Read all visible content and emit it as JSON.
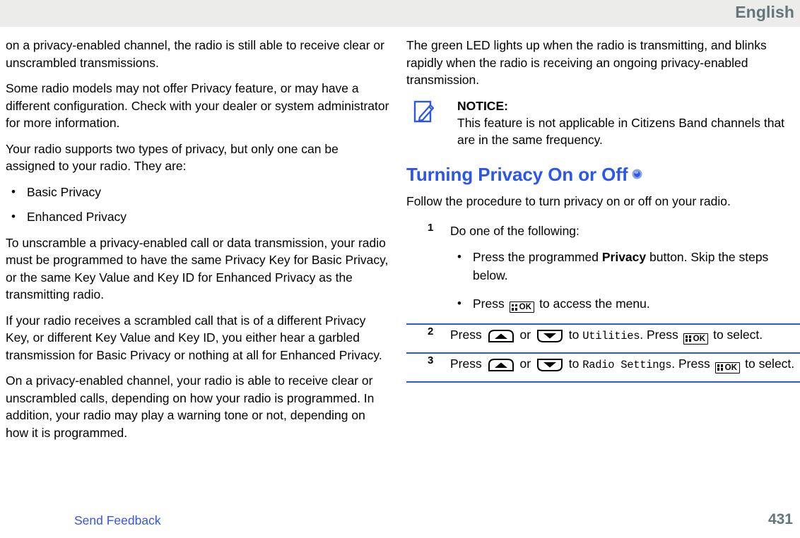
{
  "header": {
    "language": "English",
    "band_color": "#ececea",
    "text_color": "#64767c"
  },
  "left_column": {
    "paragraphs": [
      "on a privacy-enabled channel, the radio is still able to receive clear or unscrambled transmissions.",
      "Some radio models may not offer Privacy feature, or may have a different configuration. Check with your dealer or system administrator for more information.",
      "Your radio supports two types of privacy, but only one can be assigned to your radio. They are:"
    ],
    "bullets": [
      "Basic Privacy",
      "Enhanced Privacy"
    ],
    "paragraphs_after": [
      "To unscramble a privacy-enabled call or data transmission, your radio must be programmed to have the same Privacy Key for Basic Privacy, or the same Key Value and Key ID for Enhanced Privacy as the transmitting radio.",
      "If your radio receives a scrambled call that is of a different Privacy Key, or different Key Value and Key ID, you either hear a garbled transmission for Basic Privacy or nothing at all for Enhanced Privacy.",
      "On a privacy-enabled channel, your radio is able to receive clear or unscrambled calls, depending on how your radio is programmed. In addition, your radio may play a warning tone or not, depending on how it is programmed."
    ]
  },
  "right_column": {
    "intro_paragraph": "The green LED lights up when the radio is transmitting, and blinks rapidly when the radio is receiving an ongoing privacy-enabled transmission.",
    "notice": {
      "icon": "notice-pencil-icon",
      "title": "NOTICE:",
      "body": "This feature is not applicable in Citizens Band channels that are in the same frequency.",
      "icon_color": "#2b56e8"
    },
    "section": {
      "title": "Turning Privacy On or Off",
      "title_color": "#2b56e8",
      "badge_icon": "blue-circle-badge-icon",
      "lead_paragraph": "Follow the procedure to turn privacy on or off on your radio."
    },
    "steps": [
      {
        "number": "1",
        "text": "Do one of the following:",
        "sub_bullets": [
          {
            "before": "Press the programmed ",
            "bold": "Privacy",
            "after": " button. Skip the steps below."
          },
          {
            "before": "Press ",
            "key": "ok-key-icon",
            "after": " to access the menu."
          }
        ]
      },
      {
        "number": "2",
        "press_label": "Press ",
        "up_key": "up-arrow-key-icon",
        "or_label": " or ",
        "down_key": "down-arrow-key-icon",
        "to_label": " to ",
        "menu_item": "Utilities",
        "then_label": ". Press ",
        "ok_key": "ok-key-icon",
        "end_label": " to select."
      },
      {
        "number": "3",
        "press_label": "Press ",
        "up_key": "up-arrow-key-icon",
        "or_label": " or ",
        "down_key": "down-arrow-key-icon",
        "to_label": " to ",
        "menu_item": "Radio Settings",
        "then_label": ". Press ",
        "ok_key": "ok-key-icon",
        "end_label": " to select."
      }
    ],
    "rule_color": "#2b56e8"
  },
  "footer": {
    "send_feedback": "Send Feedback",
    "send_feedback_color": "#3355ee",
    "page_number": "431",
    "page_number_color": "#64767c"
  }
}
